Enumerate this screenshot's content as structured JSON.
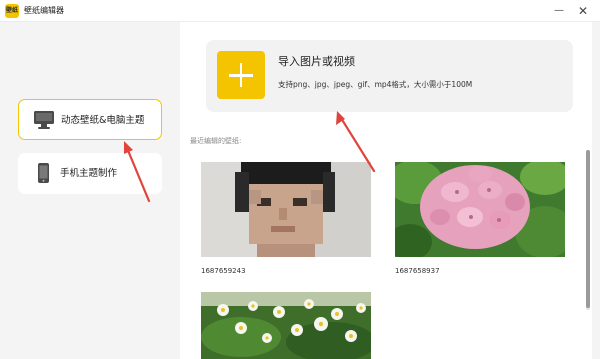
{
  "app": {
    "title": "壁纸编辑器",
    "logo_text": "壁纸",
    "minimize_label": "—",
    "close_label": "✕"
  },
  "sidebar": {
    "items": [
      {
        "label": "动态壁纸&电脑主题",
        "icon": "monitor-icon",
        "active": true
      },
      {
        "label": "手机主题制作",
        "icon": "phone-icon",
        "active": false
      }
    ]
  },
  "import": {
    "title": "导入图片或视频",
    "subtitle": "支持png、jpg、jpeg、gif、mp4格式，大小需小于100M",
    "icon": "plus-icon"
  },
  "recent": {
    "label": "最近编辑的壁纸:",
    "items": [
      {
        "caption": "1687659243",
        "type": "portrait-photo"
      },
      {
        "caption": "1687658937",
        "type": "pink-hydrangea-photo"
      },
      {
        "caption": "",
        "type": "white-daisies-photo"
      }
    ]
  },
  "colors": {
    "accent": "#f5c400",
    "annotation_arrow": "#e0443c"
  }
}
